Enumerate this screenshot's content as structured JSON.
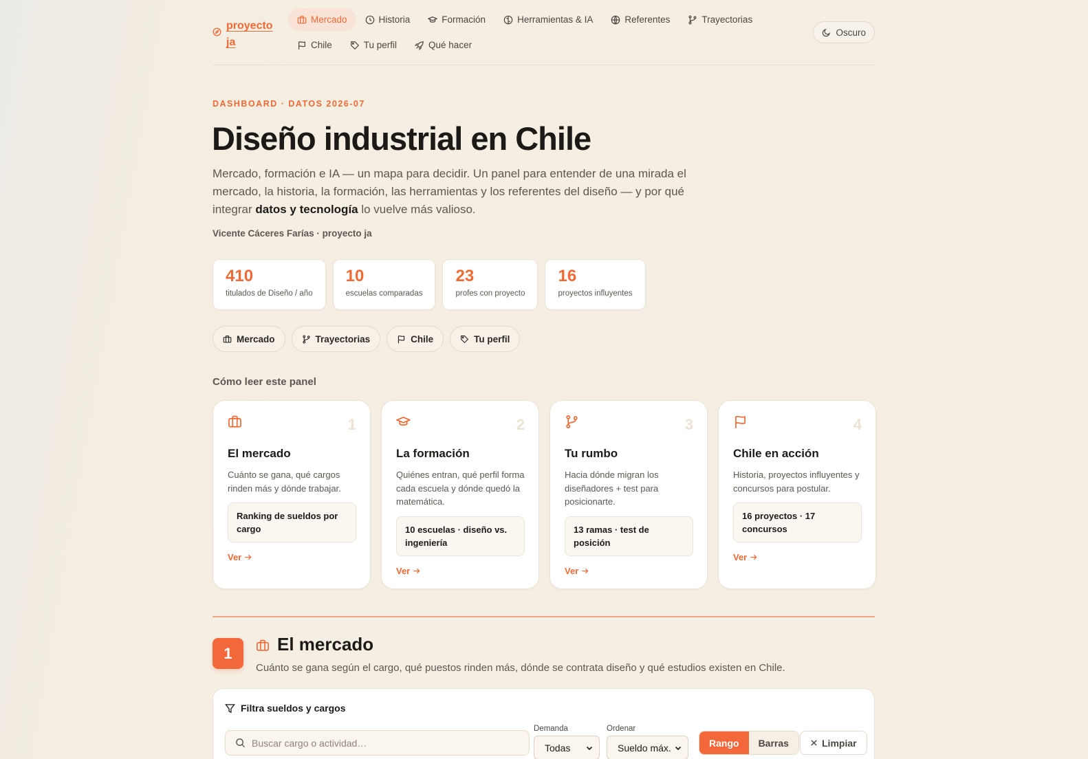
{
  "brand": {
    "name": "proyecto ja"
  },
  "nav": {
    "items": [
      {
        "label": "Mercado",
        "icon": "briefcase-icon",
        "active": true
      },
      {
        "label": "Historia",
        "icon": "clock-icon"
      },
      {
        "label": "Formación",
        "icon": "graduation-cap-icon"
      },
      {
        "label": "Herramientas & IA",
        "icon": "brain-icon"
      },
      {
        "label": "Referentes",
        "icon": "globe-icon"
      },
      {
        "label": "Trayectorias",
        "icon": "git-branch-icon"
      },
      {
        "label": "Chile",
        "icon": "flag-icon"
      },
      {
        "label": "Tu perfil",
        "icon": "tag-icon"
      },
      {
        "label": "Qué hacer",
        "icon": "rocket-icon"
      }
    ],
    "theme_label": "Oscuro"
  },
  "hero": {
    "eyebrow": "DASHBOARD · DATOS 2026-07",
    "title": "Diseño industrial en Chile",
    "lead_part1": "Mercado, formación e IA — un mapa para decidir. Un panel para entender de una mirada el mercado, la historia, la formación, las herramientas y los referentes del diseño — y por qué integrar ",
    "lead_bold": "datos y tecnología",
    "lead_part2": " lo vuelve más valioso.",
    "author": "Vicente Cáceres Farías · proyecto ja"
  },
  "stats": [
    {
      "value": "410",
      "label": "titulados de Diseño / año"
    },
    {
      "value": "10",
      "label": "escuelas comparadas"
    },
    {
      "value": "23",
      "label": "profes con proyecto"
    },
    {
      "value": "16",
      "label": "proyectos influyentes"
    }
  ],
  "chips": [
    {
      "label": "Mercado",
      "icon": "briefcase-icon"
    },
    {
      "label": "Trayectorias",
      "icon": "git-branch-icon"
    },
    {
      "label": "Chile",
      "icon": "flag-icon"
    },
    {
      "label": "Tu perfil",
      "icon": "tag-icon"
    }
  ],
  "how_to": {
    "title": "Cómo leer este panel",
    "cards": [
      {
        "num": "1",
        "title": "El mercado",
        "desc": "Cuánto se gana, qué cargos rinden más y dónde trabajar.",
        "box": "Ranking de sueldos por cargo",
        "link": "Ver"
      },
      {
        "num": "2",
        "title": "La formación",
        "desc": "Quiénes entran, qué perfil forma cada escuela y dónde quedó la matemática.",
        "box": "10 escuelas · diseño vs. ingeniería",
        "link": "Ver"
      },
      {
        "num": "3",
        "title": "Tu rumbo",
        "desc": "Hacia dónde migran los diseñadores + test para posicionarte.",
        "box": "13 ramas · test de posición",
        "link": "Ver"
      },
      {
        "num": "4",
        "title": "Chile en acción",
        "desc": "Historia, proyectos influyentes y concursos para postular.",
        "box": "16 proyectos · 17 concursos",
        "link": "Ver"
      }
    ]
  },
  "section": {
    "number": "1",
    "title": "El mercado",
    "desc": "Cuánto se gana según el cargo, qué puestos rinden más, dónde se contrata diseño y qué estudios existen en Chile."
  },
  "filters": {
    "title": "Filtra sueldos y cargos",
    "search_placeholder": "Buscar cargo o actividad…",
    "demand_label": "Demanda",
    "demand_value": "Todas",
    "order_label": "Ordenar",
    "order_value": "Sueldo máx.",
    "view_range": "Rango",
    "view_bars": "Barras",
    "clear": "Limpiar"
  },
  "colors": {
    "accent": "#f06a35",
    "background": "#f5eee3"
  }
}
